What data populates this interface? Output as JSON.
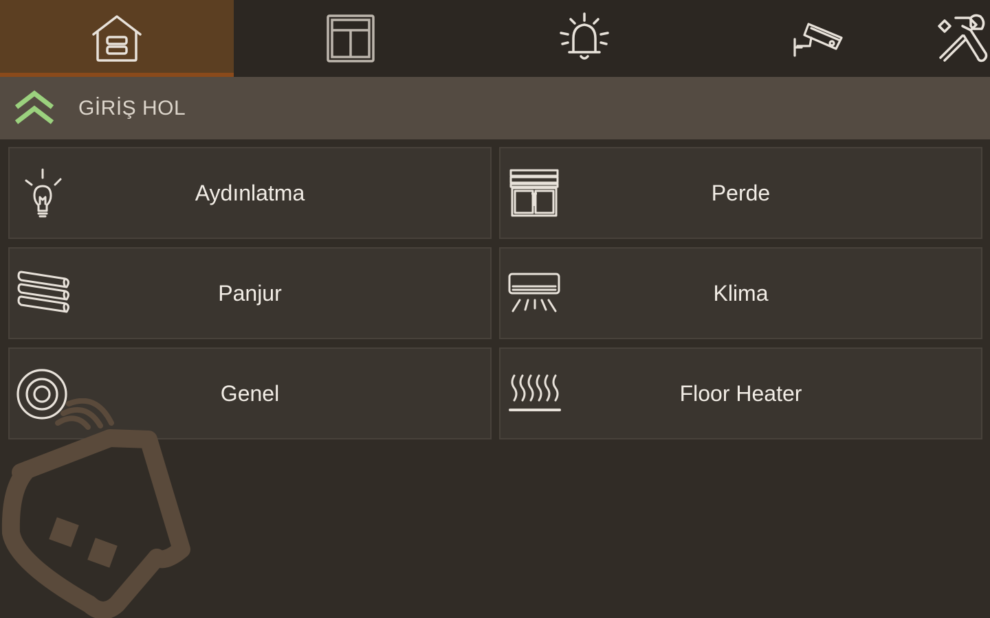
{
  "tabs": [
    {
      "icon": "home-icon",
      "active": true
    },
    {
      "icon": "window-icon",
      "active": false
    },
    {
      "icon": "alarm-bell-icon",
      "active": false
    },
    {
      "icon": "security-camera-icon",
      "active": false
    },
    {
      "icon": "tools-icon",
      "active": false
    }
  ],
  "room": {
    "title": "GİRİŞ HOL",
    "collapse_icon": "double-chevron-up-icon"
  },
  "categories": [
    {
      "label": "Aydınlatma",
      "icon": "light-bulb-icon"
    },
    {
      "label": "Perde",
      "icon": "curtain-icon"
    },
    {
      "label": "Panjur",
      "icon": "shutter-icon"
    },
    {
      "label": "Klima",
      "icon": "air-conditioner-icon"
    },
    {
      "label": "Genel",
      "icon": "general-target-icon"
    },
    {
      "label": "Floor Heater",
      "icon": "floor-heater-icon"
    }
  ],
  "colors": {
    "background": "#312c26",
    "tab_active": "#5c3f22",
    "tab_active_underline": "#8a4a1b",
    "header_bg": "#544b42",
    "accent_green": "#9bd17e",
    "tile_bg": "#3a352f"
  },
  "watermark": {
    "icon": "smart-home-logo-icon"
  }
}
